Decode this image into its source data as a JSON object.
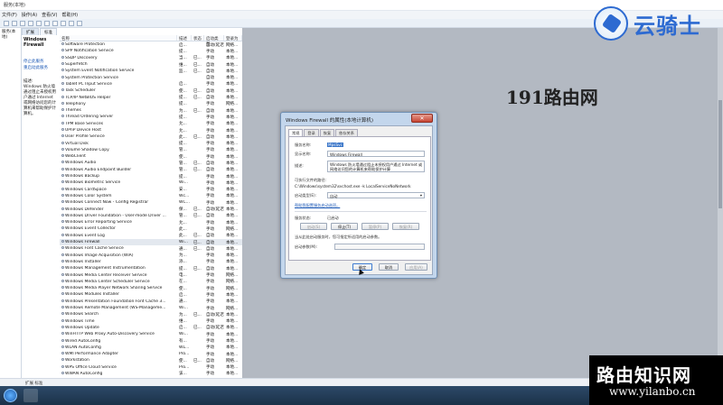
{
  "window": {
    "title": "服务(本地)",
    "menu": [
      "文件(F)",
      "操作(A)",
      "查看(V)",
      "帮助(H)"
    ]
  },
  "tree": {
    "items": [
      "服务(本地)"
    ]
  },
  "tabs": [
    "扩展",
    "标准"
  ],
  "description": {
    "name": "Windows Firewall",
    "links": [
      "停止此服务",
      "重启动此服务"
    ],
    "label": "描述:",
    "text": "Windows 防火墙通过阻止未授权用户通过 Internet 或网络访问您的计算机来帮助保护计算机。"
  },
  "table": {
    "columns": [
      "名称",
      "描述",
      "状态",
      "启动类型",
      "登录为"
    ],
    "rows": [
      {
        "name": "Software Protection",
        "desc": "启...",
        "status": "",
        "start": "自动(延迟...",
        "logon": "网络..."
      },
      {
        "name": "SPP Notification Service",
        "desc": "提...",
        "status": "",
        "start": "手动",
        "logon": "本地..."
      },
      {
        "name": "SSDP Discovery",
        "desc": "当...",
        "status": "已...",
        "start": "手动",
        "logon": "本地..."
      },
      {
        "name": "Superfetch",
        "desc": "维...",
        "status": "已...",
        "start": "自动",
        "logon": "本地..."
      },
      {
        "name": "System Event Notification Service",
        "desc": "监...",
        "status": "已...",
        "start": "自动",
        "logon": "本地..."
      },
      {
        "name": "System Protection Service",
        "desc": "",
        "status": "",
        "start": "自动",
        "logon": "本地..."
      },
      {
        "name": "Tablet PC Input Service",
        "desc": "启...",
        "status": "",
        "start": "手动",
        "logon": "本地..."
      },
      {
        "name": "Task Scheduler",
        "desc": "使...",
        "status": "已...",
        "start": "自动",
        "logon": "本地..."
      },
      {
        "name": "TCP/IP NetBIOS Helper",
        "desc": "提...",
        "status": "已...",
        "start": "自动",
        "logon": "本地..."
      },
      {
        "name": "Telephony",
        "desc": "提...",
        "status": "",
        "start": "手动",
        "logon": "网络..."
      },
      {
        "name": "Themes",
        "desc": "为...",
        "status": "已...",
        "start": "自动",
        "logon": "本地..."
      },
      {
        "name": "Thread Ordering Server",
        "desc": "提...",
        "status": "",
        "start": "手动",
        "logon": "本地..."
      },
      {
        "name": "TPM Base Services",
        "desc": "允...",
        "status": "",
        "start": "手动",
        "logon": "本地..."
      },
      {
        "name": "UPnP Device Host",
        "desc": "允...",
        "status": "",
        "start": "手动",
        "logon": "本地..."
      },
      {
        "name": "User Profile Service",
        "desc": "此...",
        "status": "已...",
        "start": "自动",
        "logon": "本地..."
      },
      {
        "name": "Virtual Disk",
        "desc": "提...",
        "status": "",
        "start": "手动",
        "logon": "本地..."
      },
      {
        "name": "Volume Shadow Copy",
        "desc": "管...",
        "status": "",
        "start": "手动",
        "logon": "本地..."
      },
      {
        "name": "WebClient",
        "desc": "使...",
        "status": "",
        "start": "手动",
        "logon": "本地..."
      },
      {
        "name": "Windows Audio",
        "desc": "管...",
        "status": "已...",
        "start": "自动",
        "logon": "本地..."
      },
      {
        "name": "Windows Audio Endpoint Builder",
        "desc": "管...",
        "status": "已...",
        "start": "自动",
        "logon": "本地..."
      },
      {
        "name": "Windows Backup",
        "desc": "提...",
        "status": "",
        "start": "手动",
        "logon": "本地..."
      },
      {
        "name": "Windows Biometric Service",
        "desc": "Wi...",
        "status": "",
        "start": "手动",
        "logon": "本地..."
      },
      {
        "name": "Windows CardSpace",
        "desc": "安...",
        "status": "",
        "start": "手动",
        "logon": "本地..."
      },
      {
        "name": "Windows Color System",
        "desc": "Wc...",
        "status": "",
        "start": "手动",
        "logon": "本地..."
      },
      {
        "name": "Windows Connect Now - Config Registrar",
        "desc": "WC...",
        "status": "",
        "start": "手动",
        "logon": "本地..."
      },
      {
        "name": "Windows Defender",
        "desc": "保...",
        "status": "已...",
        "start": "自动(延迟...",
        "logon": "本地..."
      },
      {
        "name": "Windows Driver Foundation - User-mode Driver ...",
        "desc": "管...",
        "status": "已...",
        "start": "自动",
        "logon": "本地..."
      },
      {
        "name": "Windows Error Reporting Service",
        "desc": "允...",
        "status": "",
        "start": "手动",
        "logon": "本地..."
      },
      {
        "name": "Windows Event Collector",
        "desc": "此...",
        "status": "",
        "start": "手动",
        "logon": "网络..."
      },
      {
        "name": "Windows Event Log",
        "desc": "此...",
        "status": "已...",
        "start": "自动",
        "logon": "本地..."
      },
      {
        "name": "Windows Firewall",
        "desc": "Wi...",
        "status": "已...",
        "start": "自动",
        "logon": "本地..."
      },
      {
        "name": "Windows Font Cache Service",
        "desc": "通...",
        "status": "已...",
        "start": "自动",
        "logon": "本地..."
      },
      {
        "name": "Windows Image Acquisition (WIA)",
        "desc": "为...",
        "status": "",
        "start": "手动",
        "logon": "本地..."
      },
      {
        "name": "Windows Installer",
        "desc": "添...",
        "status": "",
        "start": "手动",
        "logon": "本地..."
      },
      {
        "name": "Windows Management Instrumentation",
        "desc": "提...",
        "status": "已...",
        "start": "自动",
        "logon": "本地..."
      },
      {
        "name": "Windows Media Center Receiver Service",
        "desc": "电...",
        "status": "",
        "start": "手动",
        "logon": "网络..."
      },
      {
        "name": "Windows Media Center Scheduler Service",
        "desc": "在...",
        "status": "",
        "start": "手动",
        "logon": "网络..."
      },
      {
        "name": "Windows Media Player Network Sharing Service",
        "desc": "使...",
        "status": "",
        "start": "手动",
        "logon": "网络..."
      },
      {
        "name": "Windows Modules Installer",
        "desc": "启...",
        "status": "",
        "start": "手动",
        "logon": "本地..."
      },
      {
        "name": "Windows Presentation Foundation Font Cache 3...",
        "desc": "通...",
        "status": "",
        "start": "手动",
        "logon": "本地..."
      },
      {
        "name": "Windows Remote Management (WS-Manageme...",
        "desc": "Wi...",
        "status": "",
        "start": "手动",
        "logon": "网络..."
      },
      {
        "name": "Windows Search",
        "desc": "为...",
        "status": "已...",
        "start": "自动(延迟...",
        "logon": "本地..."
      },
      {
        "name": "Windows Time",
        "desc": "维...",
        "status": "",
        "start": "手动",
        "logon": "本地..."
      },
      {
        "name": "Windows Update",
        "desc": "启...",
        "status": "已...",
        "start": "自动(延迟...",
        "logon": "本地..."
      },
      {
        "name": "WinHTTP Web Proxy Auto-Discovery Service",
        "desc": "Wi...",
        "status": "",
        "start": "手动",
        "logon": "本地..."
      },
      {
        "name": "Wired AutoConfig",
        "desc": "有...",
        "status": "",
        "start": "手动",
        "logon": "本地..."
      },
      {
        "name": "WLAN AutoConfig",
        "desc": "WL...",
        "status": "",
        "start": "手动",
        "logon": "本地..."
      },
      {
        "name": "WMI Performance Adapter",
        "desc": "Pro...",
        "status": "",
        "start": "手动",
        "logon": "本地..."
      },
      {
        "name": "Workstation",
        "desc": "使...",
        "status": "已...",
        "start": "自动",
        "logon": "网络..."
      },
      {
        "name": "WPS Office Cloud Service",
        "desc": "Pro...",
        "status": "",
        "start": "手动",
        "logon": "本地..."
      },
      {
        "name": "WWAN AutoConfig",
        "desc": "该...",
        "status": "",
        "start": "手动",
        "logon": "本地..."
      }
    ],
    "selected_row": 30
  },
  "statusbar": {
    "text": "扩展 标准"
  },
  "dialog": {
    "title": "Windows Firewall 的属性(本地计算机)",
    "close": "✕",
    "tabs": [
      "常规",
      "登录",
      "恢复",
      "依存关系"
    ],
    "service_name_label": "服务名称:",
    "service_name": "MpsSvc",
    "display_name_label": "显示名称:",
    "display_name": "Windows Firewall",
    "description_label": "描述:",
    "description": "Windows 防火墙通过阻止未授权用户通过 Internet 或网络访问您的计算机来帮助保护计算",
    "exe_path_label": "可执行文件的路径:",
    "exe_path": "C:\\Windows\\system32\\svchost.exe -k LocalServiceNoNetwork",
    "startup_type_label": "启动类型(E):",
    "startup_type": "自动",
    "startup_help_link": "帮助我配置服务启动选项。",
    "service_status_label": "服务状态:",
    "service_status": "已启动",
    "btn_start": "启动(S)",
    "btn_stop": "停止(T)",
    "btn_pause": "暂停(P)",
    "btn_resume": "恢复(R)",
    "start_params_hint": "当从此处启动服务时，您可指定所适用的启动参数。",
    "start_params_label": "启动参数(M):",
    "btn_ok": "确定",
    "btn_cancel": "取消",
    "btn_apply": "应用(A)"
  },
  "watermarks": {
    "top_brand": "云骑士",
    "mid_text": "191路由网",
    "bottom_text": "路由知识网",
    "bottom_url": "www.yilanbo.cn"
  },
  "colors": {
    "accent": "#2d6ad1",
    "dialog_frame": "#c3d6ec",
    "selection": "#3a76c9",
    "close_button": "#c74533"
  }
}
